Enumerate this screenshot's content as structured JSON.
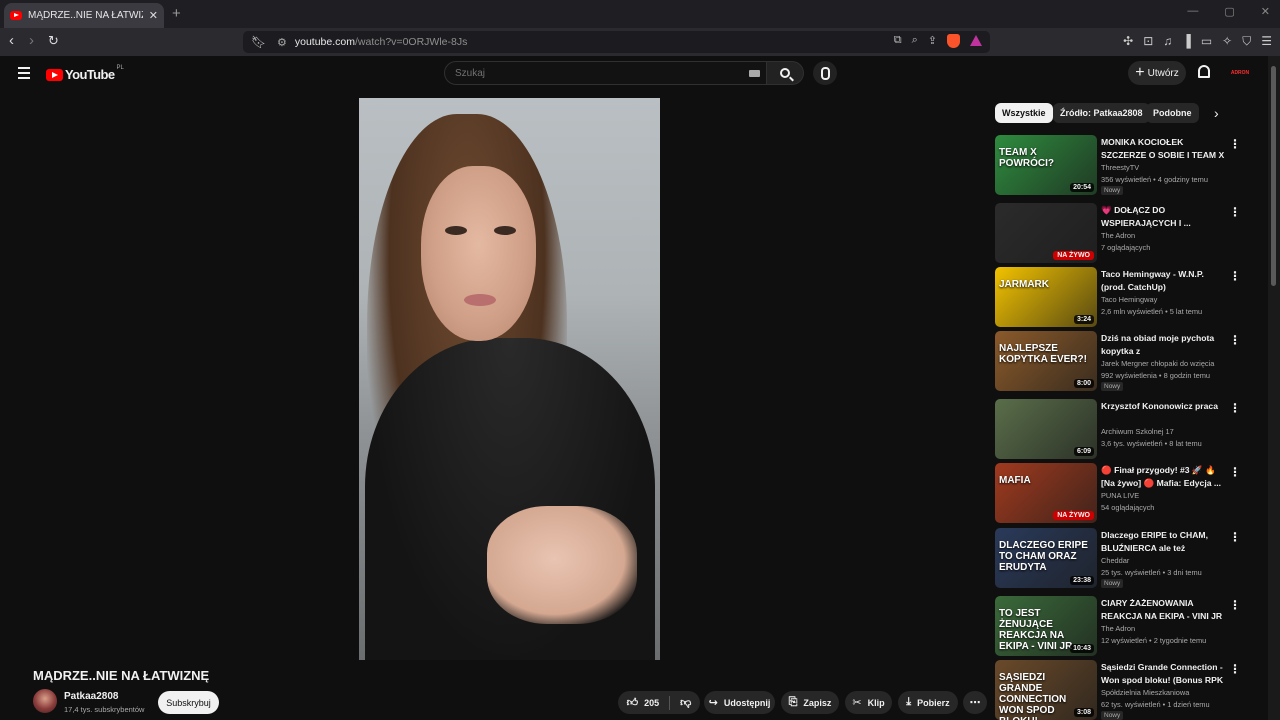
{
  "browser": {
    "tab_title": "MĄDRZE..NIE NA ŁATWIZNĘ - YouTube",
    "new_tab": "+",
    "url_domain": "youtube.com",
    "url_path": "/watch?v=0ORJWle-8Js"
  },
  "header": {
    "logo_text": "YouTube",
    "logo_region": "PL",
    "search_placeholder": "Szukaj",
    "create_label": "Utwórz",
    "avatar_text": "ADRON"
  },
  "video": {
    "title": "MĄDRZE..NIE NA ŁATWIZNĘ",
    "channel": "Patkaa2808",
    "subscribers": "17,4 tys. subskrybentów",
    "subscribe_label": "Subskrybuj",
    "likes": "205",
    "share_label": "Udostępnij",
    "save_label": "Zapisz",
    "clip_label": "Klip",
    "download_label": "Pobierz"
  },
  "chips": [
    "Wszystkie",
    "Źródło: Patkaa2808",
    "Podobne"
  ],
  "recommendations": [
    {
      "title": "MONIKA KOCIOŁEK SZCZERZE O SOBIE I TEAM X",
      "channel": "ThreestyTV",
      "meta": "356 wyświetleń • 4 godziny temu",
      "badge": "Nowy",
      "duration": "20:54",
      "overlay": "TEAM X POWRÓCI?",
      "bg": "#2e8b3e"
    },
    {
      "title": "💗 DOŁĄCZ DO WSPIERAJĄCYCH I ...",
      "channel": "The Adron",
      "meta": "7 oglądających",
      "badge": "",
      "live": "NA ŻYWO",
      "overlay": "",
      "bg": "#2b2b2b"
    },
    {
      "title": "Taco Hemingway - W.N.P. (prod. CatchUp)",
      "channel": "Taco Hemingway",
      "meta": "2,6 mln wyświetleń • 5 lat temu",
      "badge": "",
      "duration": "3:24",
      "overlay": "JARMARK",
      "bg": "#f2c200"
    },
    {
      "title": "Dziś na obiad moje pychota kopytka z",
      "channel": "Jarek Mergner chłopaki do wzięcia",
      "meta": "992 wyświetlenia • 8 godzin temu",
      "badge": "Nowy",
      "duration": "8:00",
      "overlay": "NAJLEPSZE KOPYTKA EVER?!",
      "bg": "#8a5a2a"
    },
    {
      "title": "Krzysztof Kononowicz praca",
      "channel": "Archiwum Szkolnej 17",
      "meta": "3,6 tys. wyświetleń • 8 lat temu",
      "badge": "",
      "duration": "6:09",
      "overlay": "",
      "bg": "#5a6e4a"
    },
    {
      "title": "🔴 Finał przygody! #3 🚀 🔥 [Na żywo] 🔴 Mafia: Edycja ...",
      "channel": "PUNA LIVE",
      "meta": "54 oglądających",
      "badge": "",
      "live": "NA ŻYWO",
      "overlay": "MAFIA",
      "bg": "#a03a1e"
    },
    {
      "title": "Dlaczego ERIPE to CHAM, BLUŹNIERCA ale też ERUDYTA...",
      "channel": "Cheddar",
      "meta": "25 tys. wyświetleń • 3 dni temu",
      "badge": "Nowy",
      "duration": "23:38",
      "overlay": "DLACZEGO ERIPE TO CHAM ORAZ ERUDYTA",
      "bg": "#2a3a5a"
    },
    {
      "title": "CIARY ŻAŻENOWANIA REAKCJA NA EKIPA - VINI JR",
      "channel": "The Adron",
      "meta": "12 wyświetleń • 2 tygodnie temu",
      "badge": "",
      "duration": "10:43",
      "overlay": "TO JEST ŻENUJĄCE REAKCJA NA EKIPA - VINI JR",
      "bg": "#3a6a3a"
    },
    {
      "title": "Sąsiedzi Grande Connection - Won spod bloku! (Bonus RPK ...",
      "channel": "Spółdzielnia Mieszkaniowa",
      "meta": "62 tys. wyświetleń • 1 dzień temu",
      "badge": "Nowy",
      "duration": "3:08",
      "overlay": "SĄSIEDZI GRANDE CONNECTION WON SPOD BLOKU!",
      "bg": "#6a4a2a"
    }
  ]
}
